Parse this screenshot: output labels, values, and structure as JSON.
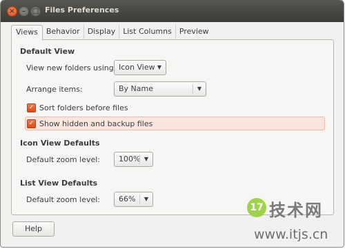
{
  "window": {
    "title": "Files Preferences",
    "controls": {
      "close": "×",
      "minimize": "–",
      "maximize": "□"
    }
  },
  "tabs": [
    {
      "label": "Views",
      "active": true
    },
    {
      "label": "Behavior",
      "active": false
    },
    {
      "label": "Display",
      "active": false
    },
    {
      "label": "List Columns",
      "active": false
    },
    {
      "label": "Preview",
      "active": false
    }
  ],
  "default_view": {
    "heading": "Default View",
    "view_new_folders_label": "View new folders using:",
    "view_new_folders_value": "Icon View",
    "arrange_items_label": "Arrange items:",
    "arrange_items_value": "By Name",
    "sort_folders_label": "Sort folders before files",
    "sort_folders_checked": true,
    "show_hidden_label": "Show hidden and backup files",
    "show_hidden_checked": true
  },
  "icon_view": {
    "heading": "Icon View Defaults",
    "zoom_label": "Default zoom level:",
    "zoom_value": "100%"
  },
  "list_view": {
    "heading": "List View Defaults",
    "zoom_label": "Default zoom level:",
    "zoom_value": "66%"
  },
  "footer": {
    "help_label": "Help"
  },
  "watermark": {
    "logo": "17",
    "name": "技术网",
    "url": "www.itjs.cn"
  },
  "colors": {
    "accent": "#dd4814",
    "titlebar": "#3c3b37",
    "highlight": "#fbe6df"
  },
  "icons": {
    "dropdown": "chevron-down-icon",
    "check": "checkmark-icon"
  }
}
